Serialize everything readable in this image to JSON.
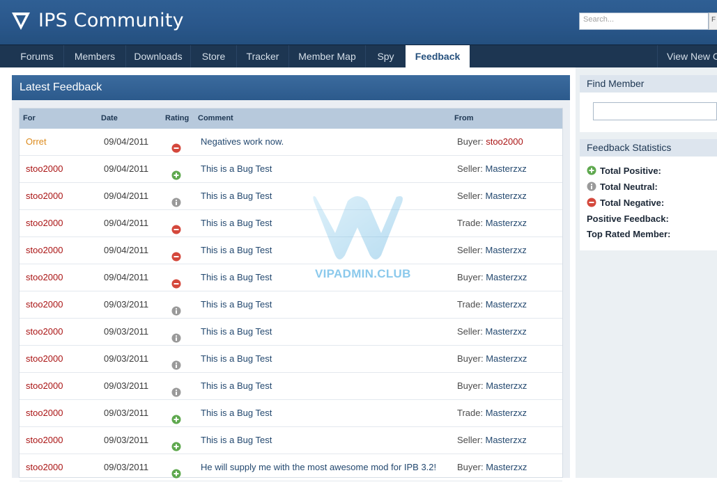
{
  "header": {
    "site_title": "IPS Community",
    "search_placeholder": "Search...",
    "search_button": "F"
  },
  "nav": {
    "items": [
      {
        "label": "Forums"
      },
      {
        "label": "Members"
      },
      {
        "label": "Downloads"
      },
      {
        "label": "Store"
      },
      {
        "label": "Tracker"
      },
      {
        "label": "Member Map"
      },
      {
        "label": "Spy"
      },
      {
        "label": "Feedback",
        "active": true
      }
    ],
    "right_link": "View New Co"
  },
  "feedback": {
    "title": "Latest Feedback",
    "columns": {
      "for": "For",
      "date": "Date",
      "rating": "Rating",
      "comment": "Comment",
      "from": "From"
    },
    "rows": [
      {
        "for": "Orret",
        "date": "09/04/2011",
        "rating": "negative",
        "comment": "Negatives work now.",
        "role": "Buyer:",
        "from": "stoo2000"
      },
      {
        "for": "stoo2000",
        "date": "09/04/2011",
        "rating": "positive",
        "comment": "This is a Bug Test",
        "role": "Seller:",
        "from": "Masterzxz"
      },
      {
        "for": "stoo2000",
        "date": "09/04/2011",
        "rating": "neutral",
        "comment": "This is a Bug Test",
        "role": "Seller:",
        "from": "Masterzxz"
      },
      {
        "for": "stoo2000",
        "date": "09/04/2011",
        "rating": "negative",
        "comment": "This is a Bug Test",
        "role": "Trade:",
        "from": "Masterzxz"
      },
      {
        "for": "stoo2000",
        "date": "09/04/2011",
        "rating": "negative",
        "comment": "This is a Bug Test",
        "role": "Seller:",
        "from": "Masterzxz"
      },
      {
        "for": "stoo2000",
        "date": "09/04/2011",
        "rating": "negative",
        "comment": "This is a Bug Test",
        "role": "Buyer:",
        "from": "Masterzxz"
      },
      {
        "for": "stoo2000",
        "date": "09/03/2011",
        "rating": "neutral",
        "comment": "This is a Bug Test",
        "role": "Trade:",
        "from": "Masterzxz"
      },
      {
        "for": "stoo2000",
        "date": "09/03/2011",
        "rating": "neutral",
        "comment": "This is a Bug Test",
        "role": "Seller:",
        "from": "Masterzxz"
      },
      {
        "for": "stoo2000",
        "date": "09/03/2011",
        "rating": "neutral",
        "comment": "This is a Bug Test",
        "role": "Buyer:",
        "from": "Masterzxz"
      },
      {
        "for": "stoo2000",
        "date": "09/03/2011",
        "rating": "neutral",
        "comment": "This is a Bug Test",
        "role": "Buyer:",
        "from": "Masterzxz"
      },
      {
        "for": "stoo2000",
        "date": "09/03/2011",
        "rating": "positive",
        "comment": "This is a Bug Test",
        "role": "Trade:",
        "from": "Masterzxz"
      },
      {
        "for": "stoo2000",
        "date": "09/03/2011",
        "rating": "positive",
        "comment": "This is a Bug Test",
        "role": "Seller:",
        "from": "Masterzxz"
      },
      {
        "for": "stoo2000",
        "date": "09/03/2011",
        "rating": "positive",
        "comment": "He will supply me with the most awesome mod for IPB 3.2!",
        "role": "Buyer:",
        "from": "Masterzxz"
      }
    ]
  },
  "sidebar": {
    "find_member": {
      "title": "Find Member"
    },
    "stats": {
      "title": "Feedback Statistics",
      "total_positive": "Total Positive:",
      "total_neutral": "Total Neutral:",
      "total_negative": "Total Negative:",
      "positive_feedback": "Positive Feedback:",
      "top_rated": "Top Rated Member:"
    }
  },
  "watermark": {
    "text": "VIPADMIN.CLUB"
  },
  "colors": {
    "header_blue": "#2a578b",
    "nav_dark": "#1d3652",
    "link_red": "#aa1414",
    "link_orange": "#dc8a1c",
    "link_blue": "#23486f",
    "positive": "#5ea84e",
    "neutral": "#9a9a9a",
    "negative": "#d4483c"
  }
}
